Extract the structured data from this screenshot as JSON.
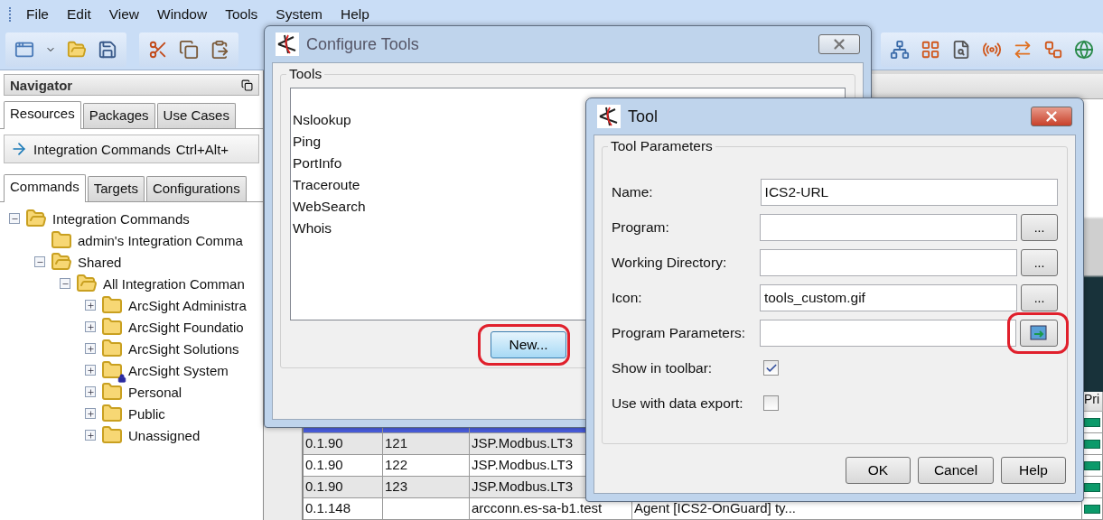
{
  "menu": [
    "File",
    "Edit",
    "View",
    "Window",
    "Tools",
    "System",
    "Help"
  ],
  "navigator": {
    "title": "Navigator",
    "tabs": [
      {
        "label": "Resources",
        "selected": true
      },
      {
        "label": "Packages",
        "selected": false
      },
      {
        "label": "Use Cases",
        "selected": false
      }
    ],
    "selector": {
      "label": "Integration Commands",
      "shortcut": "Ctrl+Alt+"
    },
    "subtabs": [
      {
        "label": "Commands",
        "selected": true
      },
      {
        "label": "Targets",
        "selected": false
      },
      {
        "label": "Configurations",
        "selected": false
      }
    ],
    "tree": [
      {
        "label": "Integration Commands",
        "expanded": true,
        "children": [
          {
            "label": "admin's Integration Comma"
          },
          {
            "label": "Shared",
            "expanded": true,
            "children": [
              {
                "label": "All Integration Comman",
                "expanded": true,
                "children": [
                  {
                    "label": "ArcSight Administra",
                    "expanded": false,
                    "locked": false
                  },
                  {
                    "label": "ArcSight Foundatio",
                    "expanded": false,
                    "locked": false
                  },
                  {
                    "label": "ArcSight Solutions",
                    "expanded": false,
                    "locked": false
                  },
                  {
                    "label": "ArcSight System",
                    "expanded": false,
                    "locked": true
                  },
                  {
                    "label": "Personal",
                    "expanded": false,
                    "locked": false
                  },
                  {
                    "label": "Public",
                    "expanded": false,
                    "locked": false
                  },
                  {
                    "label": "Unassigned",
                    "expanded": false,
                    "locked": false
                  }
                ]
              }
            ]
          }
        ]
      }
    ]
  },
  "table": {
    "columns": [
      {
        "label": "Pri"
      }
    ],
    "rows": [
      {
        "selected": true
      },
      {
        "selected": false,
        "column_1": "0.1.90",
        "column_2": "121",
        "column_3": "JSP.Modbus.LT3"
      },
      {
        "selected": false,
        "column_1": "0.1.90",
        "column_2": "122",
        "column_3": "JSP.Modbus.LT3"
      },
      {
        "selected": false,
        "column_1": "0.1.90",
        "column_2": "123",
        "column_3": "JSP.Modbus.LT3"
      },
      {
        "selected": false,
        "column_1": "0.1.148",
        "column_3": "arcconn.es-sa-b1.test",
        "column_4": "Agent [ICS2-OnGuard] ty..."
      }
    ]
  },
  "configure_dialog": {
    "title": "Configure Tools",
    "group": "Tools",
    "tools": [
      "Nslookup",
      "Ping",
      "PortInfo",
      "Traceroute",
      "WebSearch",
      "Whois"
    ],
    "new_button": "New..."
  },
  "tool_dialog": {
    "title": "Tool",
    "group": "Tool Parameters",
    "fields": [
      {
        "kind": "text",
        "label": "Name:",
        "value": "ICS2-URL"
      },
      {
        "kind": "browse",
        "label": "Program:",
        "button": "..."
      },
      {
        "kind": "browse",
        "label": "Working Directory:",
        "button": "..."
      },
      {
        "kind": "browse",
        "label": "Icon:",
        "value": "tools_custom.gif",
        "button": "..."
      },
      {
        "kind": "picker",
        "label": "Program Parameters:"
      },
      {
        "kind": "checkbox",
        "label": "Show in toolbar:",
        "checked": true
      },
      {
        "kind": "checkbox",
        "label": "Use with data export:",
        "checked": false
      }
    ],
    "buttons": [
      "OK",
      "Cancel",
      "Help"
    ]
  }
}
